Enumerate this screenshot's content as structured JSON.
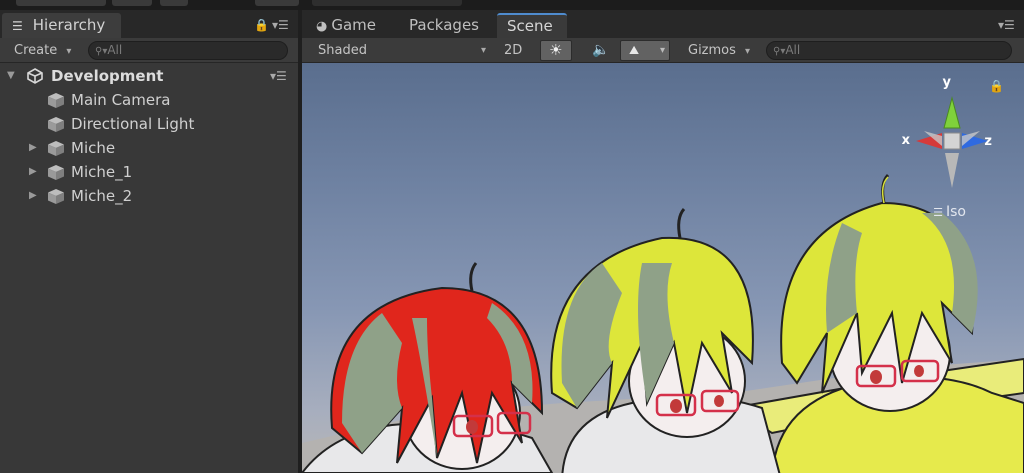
{
  "hierarchy": {
    "tab_label": "Hierarchy",
    "create_label": "Create",
    "search_placeholder": "All",
    "root": {
      "label": "Development"
    },
    "items": [
      {
        "label": "Main Camera",
        "has_children": false
      },
      {
        "label": "Directional Light",
        "has_children": false
      },
      {
        "label": "Miche",
        "has_children": true
      },
      {
        "label": "Miche_1",
        "has_children": true
      },
      {
        "label": "Miche_2",
        "has_children": true
      }
    ]
  },
  "scene": {
    "tabs": [
      {
        "label": "Game"
      },
      {
        "label": "Packages"
      },
      {
        "label": "Scene",
        "active": true
      }
    ],
    "draw_mode": "Shaded",
    "mode_2d": "2D",
    "gizmos_label": "Gizmos",
    "search_placeholder": "All",
    "iso_label": "Iso",
    "axes": {
      "x": "x",
      "y": "y",
      "z": "z"
    }
  },
  "colors": {
    "accent": "#4f8ccf",
    "hair_red": "#e0261c",
    "hair_yellow": "#e4ec2c",
    "hair_green": "#8a9e86",
    "glasses": "#d4304a",
    "axis_x": "#d63a3a",
    "axis_y": "#7fd13b",
    "axis_z": "#2f6ae0"
  }
}
